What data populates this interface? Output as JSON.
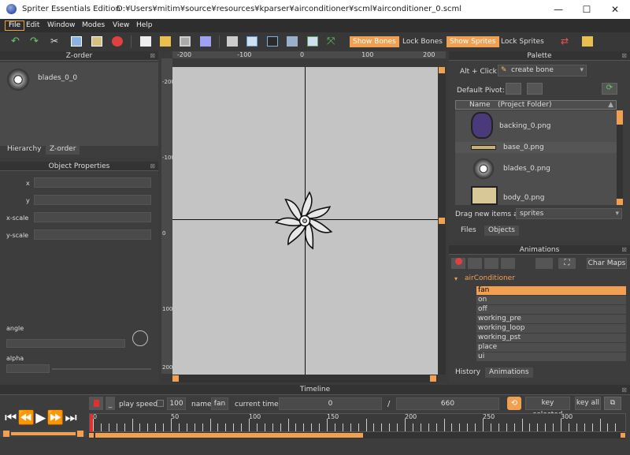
{
  "title": {
    "app": "Spriter Essentials Edition",
    "path": "D:¥Users¥mitim¥source¥resources¥kparser¥airconditioner¥scml¥airconditioner_0.scml"
  },
  "menu": [
    "File",
    "Edit",
    "Window",
    "Modes",
    "View",
    "Help"
  ],
  "toolbar": {
    "show_bones": "Show Bones",
    "lock_bones": "Lock Bones",
    "show_sprites": "Show Sprites",
    "lock_sprites": "Lock Sprites"
  },
  "zorder": {
    "header": "Z-order",
    "item": "blades_0_0",
    "tabs": [
      "Hierarchy",
      "Z-order"
    ]
  },
  "object_properties": {
    "header": "Object Properties",
    "x": "x",
    "y": "y",
    "x_scale": "x-scale",
    "y_scale": "y-scale",
    "angle": "angle",
    "alpha": "alpha"
  },
  "canvas": {
    "top_ticks": [
      {
        "v": -200,
        "x": 0.04
      },
      {
        "v": -100,
        "x": 0.26
      },
      {
        "v": 0,
        "x": 0.49
      },
      {
        "v": 100,
        "x": 0.715
      },
      {
        "v": 200,
        "x": 0.94
      }
    ],
    "left_ticks": [
      {
        "v": -200,
        "y": 0.065
      },
      {
        "v": -100,
        "y": 0.305
      },
      {
        "v": 0,
        "y": 0.545
      },
      {
        "v": 100,
        "y": 0.785
      },
      {
        "v": 200,
        "y": 1.0
      }
    ]
  },
  "palette": {
    "header": "Palette",
    "alt_click": "Alt + Click:",
    "bone_option": "create bone",
    "default_pivot": "Default Pivot:",
    "col_name": "Name",
    "col_folder": "(Project Folder)",
    "items": [
      "backing_0.png",
      "base_0.png",
      "blades_0.png",
      "body_0.png"
    ],
    "drag_label": "Drag new items as",
    "drag_value": "sprites",
    "tabs": [
      "Files",
      "Objects"
    ]
  },
  "animations": {
    "header": "Animations",
    "char_maps": "Char Maps",
    "entity": "airConditioner",
    "list": [
      "fan",
      "on",
      "off",
      "working_pre",
      "working_loop",
      "working_pst",
      "place",
      "ui"
    ],
    "tabs": [
      "History",
      "Animations"
    ]
  },
  "timeline": {
    "header": "Timeline",
    "play_speed_label": "play speed",
    "play_speed": "100",
    "name_label": "name",
    "name": "fan",
    "current_time_label": "current time:",
    "current_time": "0",
    "slash": "/",
    "length": "660",
    "key_selected": "key selected",
    "key_all": "key all",
    "ticks": [
      "0",
      "50",
      "100",
      "150",
      "200",
      "250",
      "300"
    ]
  },
  "colors": {
    "accent": "#f0a050",
    "canvas_bg": "#c4c4c4",
    "panel": "#3d3d3d"
  }
}
